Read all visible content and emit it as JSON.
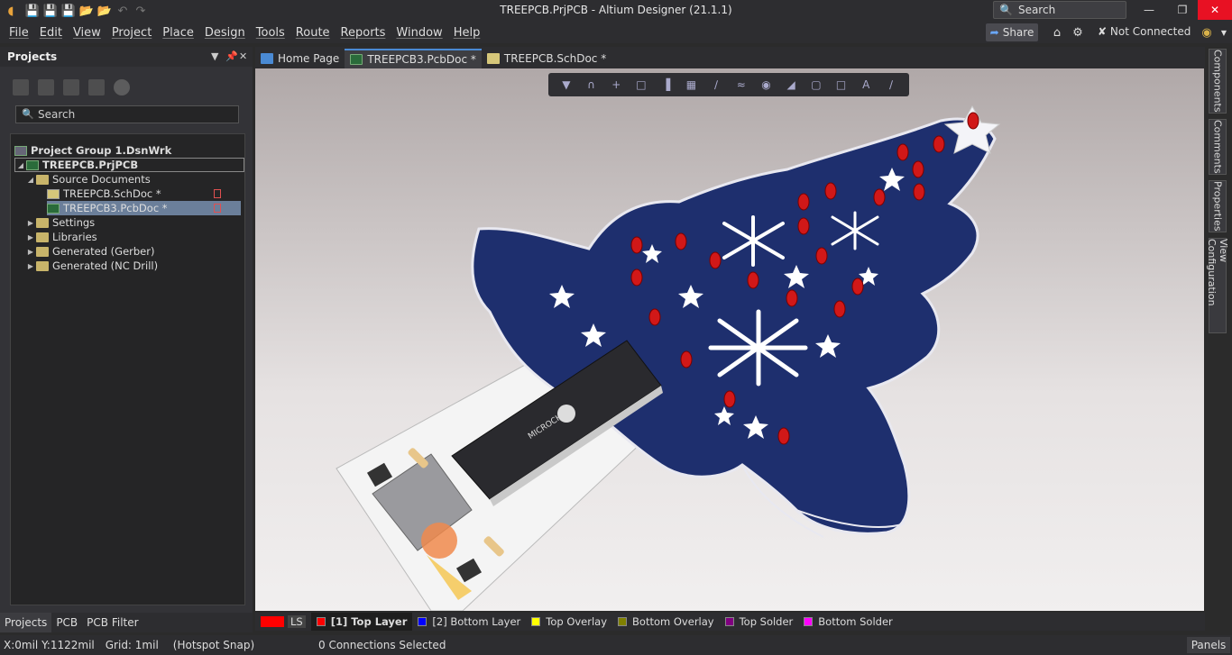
{
  "title": "TREEPCB.PrjPCB - Altium Designer (21.1.1)",
  "search": {
    "placeholder": "Search"
  },
  "menu": [
    "File",
    "Edit",
    "View",
    "Project",
    "Place",
    "Design",
    "Tools",
    "Route",
    "Reports",
    "Window",
    "Help"
  ],
  "share_label": "Share",
  "connection_status": "Not Connected",
  "projects_panel": {
    "title": "Projects",
    "search_placeholder": "Search",
    "tree": [
      {
        "label": "Project Group 1.DsnWrk",
        "level": 0,
        "type": "group"
      },
      {
        "label": "TREEPCB.PrjPCB",
        "level": 1,
        "type": "project",
        "bold": true
      },
      {
        "label": "Source Documents",
        "level": 2,
        "type": "folder"
      },
      {
        "label": "TREEPCB.SchDoc *",
        "level": 3,
        "type": "sch"
      },
      {
        "label": "TREEPCB3.PcbDoc *",
        "level": 3,
        "type": "pcb",
        "selected": true
      },
      {
        "label": "Settings",
        "level": 2,
        "type": "folder"
      },
      {
        "label": "Libraries",
        "level": 2,
        "type": "folder"
      },
      {
        "label": "Generated (Gerber)",
        "level": 2,
        "type": "folder"
      },
      {
        "label": "Generated (NC Drill)",
        "level": 2,
        "type": "folder"
      }
    ],
    "tabs": [
      "Projects",
      "PCB",
      "PCB Filter"
    ]
  },
  "doc_tabs": [
    {
      "label": "Home Page",
      "icon": "home-icon"
    },
    {
      "label": "TREEPCB3.PcbDoc *",
      "icon": "pcb-doc-icon",
      "active": true
    },
    {
      "label": "TREEPCB.SchDoc *",
      "icon": "sch-doc-icon"
    }
  ],
  "right_panels": [
    "Components",
    "Comments",
    "Properties",
    "View Configuration"
  ],
  "layers": [
    {
      "label": "LS",
      "color": "#ff0000",
      "active": false,
      "swatch_only": true
    },
    {
      "label": "[1] Top Layer",
      "color": "#ff0000",
      "active": true
    },
    {
      "label": "[2] Bottom Layer",
      "color": "#0000ff",
      "active": false
    },
    {
      "label": "Top Overlay",
      "color": "#ffff00",
      "active": false
    },
    {
      "label": "Bottom Overlay",
      "color": "#808000",
      "active": false
    },
    {
      "label": "Top Solder",
      "color": "#800080",
      "active": false
    },
    {
      "label": "Bottom Solder",
      "color": "#ff00ff",
      "active": false
    }
  ],
  "status": {
    "coords": "X:0mil Y:1122mil",
    "grid": "Grid: 1mil",
    "snap": "(Hotspot Snap)",
    "selection": "0 Connections Selected",
    "panels_btn": "Panels"
  },
  "board_marking": "MICROCHIP"
}
